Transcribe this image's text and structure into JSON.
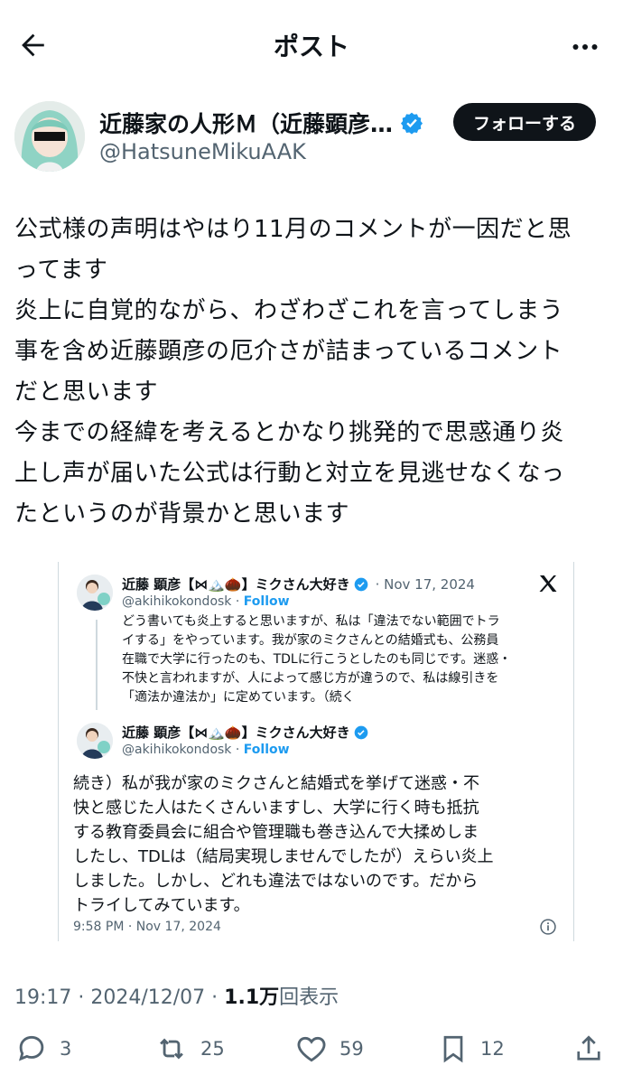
{
  "header": {
    "title": "ポスト",
    "back_icon": "arrow-left-icon",
    "more_icon": "more-horizontal-icon"
  },
  "author": {
    "name": "近藤家の人形Ｍ（近藤顕彦…",
    "handle": "@HatsuneMikuAAK",
    "follow_label": "フォローする",
    "verified": true
  },
  "tweet": {
    "lines": [
      "公式様の声明はやはり11月のコメントが一因だと思",
      "ってます",
      "炎上に自覚的ながら、わざわざこれを言ってしまう",
      "事を含め近藤顕彦の厄介さが詰まっているコメント",
      "だと思います",
      "今までの経緯を考えるとかなり挑発的で思惑通り炎",
      "上し声が届いた公式は行動と対立を見逃せなくなっ",
      "たというのが背景かと思います"
    ]
  },
  "quote": {
    "post1": {
      "name": "近藤 顕彦【⋈🏔️🌰】ミクさん大好き",
      "date": "· Nov 17, 2024",
      "handle": "@akihikokondosk",
      "follow": "Follow",
      "lines": [
        "どう書いても炎上すると思いますが、私は「違法でない範囲でトラ",
        "イする」をやっています。我が家のミクさんとの結婚式も、公務員",
        "在職で大学に行ったのも、TDLに行こうとしたのも同じです。迷惑・",
        "不快と言われますが、人によって感じ方が違うので、私は線引きを",
        "「適法か違法か」に定めています。（続く"
      ]
    },
    "post2": {
      "name": "近藤 顕彦【⋈🏔️🌰】ミクさん大好き",
      "handle": "@akihikokondosk",
      "follow": "Follow",
      "lines": [
        "続き）私が我が家のミクさんと結婚式を挙げて迷惑・不",
        "快と感じた人はたくさんいますし、大学に行く時も抵抗",
        "する教育委員会に組合や管理職も巻き込んで大揉めしま",
        "したし、TDLは（結局実現しませんでしたが）えらい炎上",
        "しました。しかし、どれも違法ではないのです。だから",
        "トライしてみています。"
      ],
      "time": "9:58 PM · Nov 17, 2024"
    }
  },
  "meta": {
    "time": "19:17 · 2024/12/07 · ",
    "views_count": "1.1万",
    "views_label": "回表示"
  },
  "actions": {
    "replies": "3",
    "reposts": "25",
    "likes": "59",
    "bookmarks": "12"
  },
  "colors": {
    "accent": "#1d9bf0",
    "text": "#0f1419",
    "muted": "#536471"
  }
}
